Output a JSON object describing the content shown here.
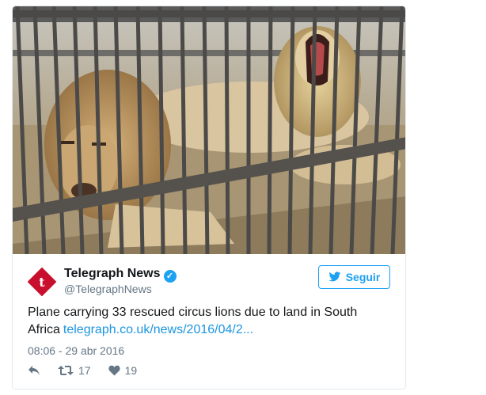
{
  "tweet": {
    "author_name": "Telegraph News",
    "author_handle": "@TelegraphNews",
    "follow_label": "Seguir",
    "text": "Plane carrying 33 rescued circus lions due to land in South Africa",
    "link": "telegraph.co.uk/news/2016/04/2...",
    "timestamp": "08:06 - 29 abr 2016",
    "retweets": "17",
    "likes": "19"
  },
  "colors": {
    "accent": "#1da1f2",
    "logo_red": "#c8102e",
    "link": "#1b95e0"
  },
  "icons": [
    "reply-icon",
    "retweet-icon",
    "heart-icon",
    "verified-icon",
    "bird-icon"
  ]
}
